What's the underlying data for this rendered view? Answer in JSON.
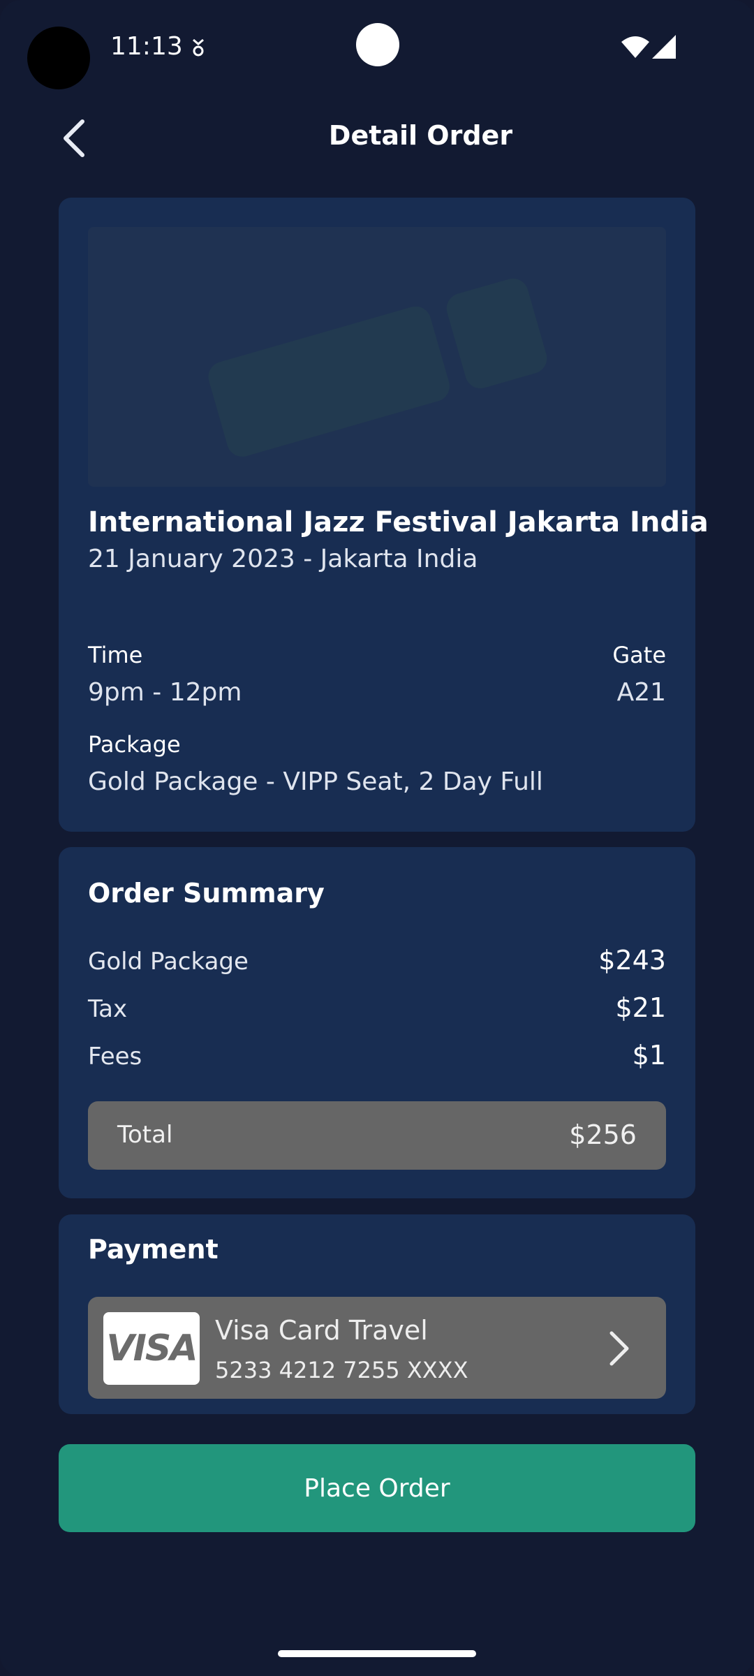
{
  "status_bar": {
    "time": "11:13"
  },
  "header": {
    "title": "Detail Order"
  },
  "event": {
    "title": "International Jazz Festival Jakarta India",
    "subtitle": "21 January 2023 - Jakarta India",
    "time_label": "Time",
    "time_value": "9pm - 12pm",
    "gate_label": "Gate",
    "gate_value": "A21",
    "package_label": "Package",
    "package_value": "Gold Package - VIPP Seat, 2 Day Full"
  },
  "summary": {
    "title": "Order Summary",
    "rows": [
      {
        "label": "Gold Package",
        "value": "$243"
      },
      {
        "label": "Tax",
        "value": "$21"
      },
      {
        "label": "Fees",
        "value": "$1"
      }
    ],
    "total_label": "Total",
    "total_value": "$256"
  },
  "payment": {
    "title": "Payment",
    "card_brand": "VISA",
    "card_name": "Visa Card Travel",
    "card_number": "5233 4212 7255 XXXX"
  },
  "actions": {
    "place_order": "Place Order"
  },
  "colors": {
    "background": "#121a32",
    "card": "#182d52",
    "accent": "#22967c",
    "neutral": "#666666"
  }
}
